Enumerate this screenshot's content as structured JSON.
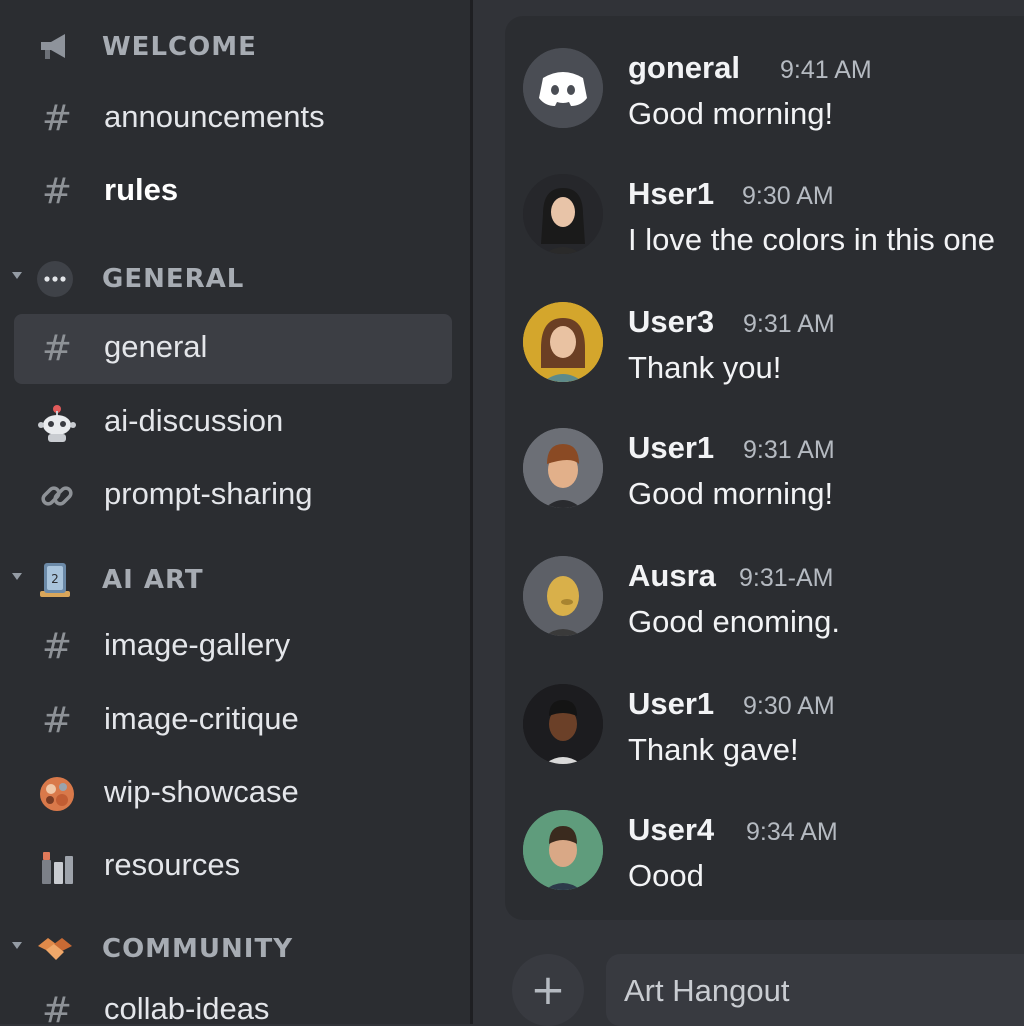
{
  "sidebar": {
    "categories": [
      {
        "label": "WELCOME",
        "icon": "megaphone-icon"
      },
      {
        "label": "GENERAL",
        "icon": "chat-bubble-icon"
      },
      {
        "label": "AI ART",
        "icon": "framed-picture-icon"
      },
      {
        "label": "COMMUNITY",
        "icon": "handshake-icon"
      }
    ],
    "channels": [
      {
        "label": "announcements",
        "icon": "hash-icon"
      },
      {
        "label": "rules",
        "icon": "hash-icon"
      },
      {
        "label": "general",
        "icon": "hash-icon",
        "active": true
      },
      {
        "label": "ai-discussion",
        "icon": "robot-icon"
      },
      {
        "label": "prompt-sharing",
        "icon": "link-icon"
      },
      {
        "label": "image-gallery",
        "icon": "hash-icon"
      },
      {
        "label": "image-critique",
        "icon": "hash-icon"
      },
      {
        "label": "wip-showcase",
        "icon": "artist-palette-icon"
      },
      {
        "label": "resources",
        "icon": "books-icon"
      },
      {
        "label": "collab-ideas",
        "icon": "hash-icon"
      }
    ],
    "hash_glyph": "#"
  },
  "messages": [
    {
      "username": "goneral",
      "time": "9:41 AM",
      "text": "Good morning!",
      "avatar": "discord-logo-avatar"
    },
    {
      "username": "Hser1",
      "time": "9:30 AM",
      "text": "I love the colors in this one",
      "avatar": "woman-dark-hair-avatar"
    },
    {
      "username": "User3",
      "time": "9:31 AM",
      "text": "Thank you!",
      "avatar": "woman-brown-hair-avatar"
    },
    {
      "username": "User1",
      "time": "9:31 AM",
      "text": "Good morning!",
      "avatar": "boy-cartoon-avatar"
    },
    {
      "username": "Ausra",
      "time": "9:31-AM",
      "text": "Good enoming.",
      "avatar": "yellow-figure-avatar"
    },
    {
      "username": "User1",
      "time": "9:30 AM",
      "text": "Thank gave!",
      "avatar": "man-dark-skin-avatar"
    },
    {
      "username": "User4",
      "time": "9:34 AM",
      "text": "Oood",
      "avatar": "man-green-bg-avatar"
    }
  ],
  "composer": {
    "placeholder": "Art Hangout",
    "add_icon": "plus-icon",
    "add_glyph": "+"
  },
  "colors": {
    "sidebar_bg": "#2b2d31",
    "main_bg": "#313338",
    "panel_bg": "#2b2d31",
    "active_channel_bg": "#3c3e44",
    "muted_text": "#949ba4",
    "text": "#f2f3f5"
  }
}
